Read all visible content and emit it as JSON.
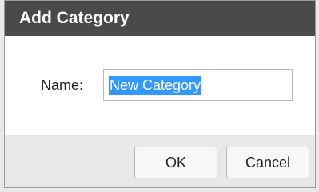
{
  "dialog": {
    "title": "Add Category",
    "name_label": "Name:",
    "name_value": "New Category",
    "ok_label": "OK",
    "cancel_label": "Cancel"
  }
}
